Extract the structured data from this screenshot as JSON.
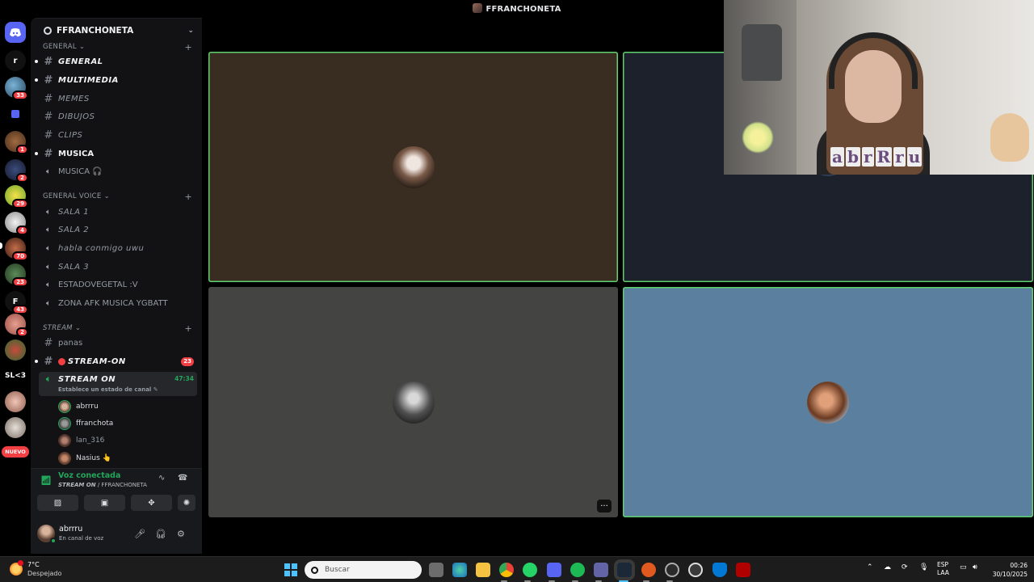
{
  "window": {
    "title": "FFRANCHONETA"
  },
  "rail": {
    "servers": [
      {
        "name": "discord-home",
        "label": ""
      },
      {
        "name": "r-server",
        "label": "r"
      },
      {
        "name": "server-a",
        "badge": "33"
      },
      {
        "name": "server-folder",
        "label": ""
      },
      {
        "name": "server-b",
        "badge": "1"
      },
      {
        "name": "server-c",
        "badge": "2"
      },
      {
        "name": "server-d",
        "badge": "29"
      },
      {
        "name": "server-e",
        "badge": "4"
      },
      {
        "name": "server-f",
        "badge": "70"
      },
      {
        "name": "server-g",
        "badge": "23"
      },
      {
        "name": "f-server",
        "label": "F",
        "badge": "43"
      },
      {
        "name": "server-h",
        "badge": "2"
      },
      {
        "name": "server-i",
        "label": ""
      },
      {
        "name": "sl3-server",
        "label": "SL<3"
      },
      {
        "name": "server-j",
        "label": ""
      },
      {
        "name": "server-k",
        "label": ""
      }
    ],
    "new_label": "NUEVO"
  },
  "sidebar": {
    "server_name": "FFRANCHONETA",
    "categories": {
      "general": "GENERAL",
      "general_voice": "GENERAL VOICE",
      "stream": "STREAM"
    },
    "text_channels": [
      {
        "label": "GENERAL",
        "unread": true
      },
      {
        "label": "MULTIMEDIA",
        "unread": true
      },
      {
        "label": "MEMES",
        "unread": false
      },
      {
        "label": "DIBUJOS",
        "unread": false
      },
      {
        "label": "CLIPS",
        "unread": false
      },
      {
        "label": "MUSICA",
        "unread": true
      }
    ],
    "musica_voice": "MUSICA 🎧",
    "voice_channels": [
      {
        "label": "SALA 1"
      },
      {
        "label": "SALA 2"
      },
      {
        "label": "habla conmigo uwu"
      },
      {
        "label": "SALA 3"
      },
      {
        "label": "ESTADOVEGETAL :V"
      },
      {
        "label": "ZONA AFK MUSICA YGBATT"
      }
    ],
    "stream_channels": {
      "panas": "panas",
      "stream_on_text": "STREAM-ON",
      "stream_on_badge": "23",
      "stream_on_voice": "STREAM ON",
      "timer": "47:34",
      "channel_status_hint": "Establece un estado de canal ✎"
    },
    "voice_users": [
      {
        "name": "abrrru",
        "speaking": true
      },
      {
        "name": "ffranchota",
        "speaking": true
      },
      {
        "name": "lan_316",
        "speaking": false
      },
      {
        "name": "Nasius 👆",
        "speaking": false
      }
    ]
  },
  "voice_panel": {
    "status": "Voz conectada",
    "channel": "STREAM ON",
    "server": " / FFRANCHONETA"
  },
  "user_panel": {
    "username": "abrrru",
    "status": "En canal de voz"
  },
  "stage": {
    "tiles": [
      {
        "name": "tile-user-1",
        "bg": "#392c20",
        "speaking": true
      },
      {
        "name": "tile-user-2",
        "bg": "#1c212c",
        "speaking": true
      },
      {
        "name": "tile-user-3",
        "bg": "#444443",
        "speaking": false
      },
      {
        "name": "tile-user-4",
        "bg": "#5a7f9f",
        "speaking": true
      }
    ],
    "more_label": "···"
  },
  "webcam": {
    "overlay_text": [
      "a",
      "b",
      "r",
      "R",
      "r",
      "u"
    ]
  },
  "taskbar": {
    "weather_temp": "7°C",
    "weather_desc": "Despejado",
    "search_placeholder": "Buscar",
    "lang_1": "ESP",
    "lang_2": "LAA",
    "time": "00:26",
    "date": "30/10/2025"
  },
  "colors": {
    "speaking": "#5fd16e",
    "online": "#23a55a",
    "alert": "#f23f43"
  }
}
